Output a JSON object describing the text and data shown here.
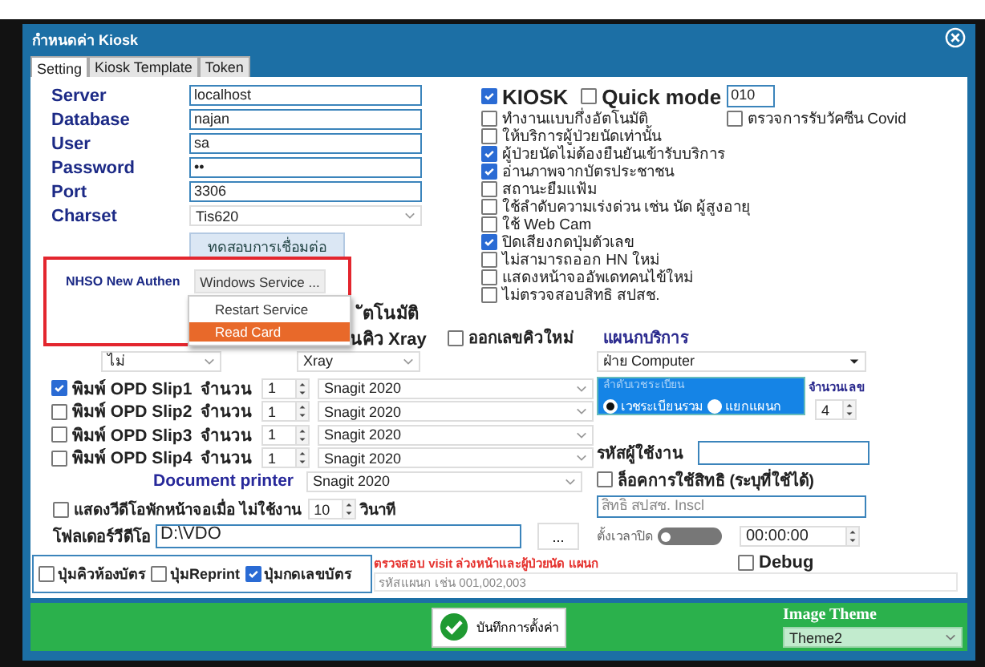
{
  "window": {
    "title": "กำหนดค่า Kiosk"
  },
  "tabs": [
    {
      "label": "Setting",
      "selected": true
    },
    {
      "label": "Kiosk Template",
      "selected": false
    },
    {
      "label": "Token",
      "selected": false
    }
  ],
  "connection": {
    "fields": [
      {
        "label": "Server",
        "value": "localhost",
        "kind": "text"
      },
      {
        "label": "Database",
        "value": "najan",
        "kind": "text"
      },
      {
        "label": "User",
        "value": "sa",
        "kind": "text"
      },
      {
        "label": "Password",
        "value": "••",
        "kind": "text"
      },
      {
        "label": "Port",
        "value": "3306",
        "kind": "text"
      },
      {
        "label": "Charset",
        "value": "Tis620",
        "kind": "select"
      }
    ],
    "test_button": "ทดสอบการเชื่อมต่อ"
  },
  "nhso": {
    "label": "NHSO New Authen",
    "button": "Windows Service ...",
    "menu": [
      {
        "label": "Restart Service",
        "selected": false
      },
      {
        "label": "Read Card",
        "selected": true
      }
    ]
  },
  "kiosk": {
    "label": "KIOSK",
    "checked": true
  },
  "quick_mode": {
    "label": "Quick mode",
    "checked": false,
    "value": "010"
  },
  "covid": {
    "label": "ตรวจการรับวัคซีน Covid",
    "checked": false
  },
  "options": [
    {
      "label": "ทำงานแบบกึ่งอัตโนมัติ",
      "checked": false
    },
    {
      "label": "ให้บริการผู้ป่วยนัดเท่านั้น",
      "checked": false
    },
    {
      "label": "ผู้ป่วยนัดไม่ต้องยืนยันเข้ารับบริการ",
      "checked": true
    },
    {
      "label": "อ่านภาพจากบัตรประชาชน",
      "checked": true
    },
    {
      "label": "สถานะยืมแฟ้ม",
      "checked": false
    },
    {
      "label": "ใช้ลำดับความเร่งด่วน เช่น นัด ผู้สูงอายุ",
      "checked": false
    },
    {
      "label": "ใช้ Web Cam",
      "checked": false
    },
    {
      "label": "ปิดเสียงกดปุ่มตัวเลข",
      "checked": true
    },
    {
      "label": "ไม่สามารถออก HN ใหม่",
      "checked": false
    },
    {
      "label": "แสดงหน้าจออัพเดทคนไข้ใหม่",
      "checked": false
    },
    {
      "label": "ไม่ตรวจสอบสิทธิ สปสช.",
      "checked": false
    }
  ],
  "partial": {
    "text_1": "ัตโนมัติ",
    "text_2": "นคิว Xray",
    "new_queue": {
      "label": "ออกเลขคิวใหม่",
      "checked": false
    },
    "select_1": "ไม่",
    "select_2": "Xray"
  },
  "department": {
    "label": "แผนกบริการ",
    "value": "ฝ่าย Computer"
  },
  "print_slips": [
    {
      "label": "พิมพ์ OPD Slip1",
      "checked": true,
      "count_label": "จำนวน",
      "count": "1",
      "printer": "Snagit 2020"
    },
    {
      "label": "พิมพ์ OPD Slip2",
      "checked": false,
      "count_label": "จำนวน",
      "count": "1",
      "printer": "Snagit 2020"
    },
    {
      "label": "พิมพ์ OPD Slip3",
      "checked": false,
      "count_label": "จำนวน",
      "count": "1",
      "printer": "Snagit 2020"
    },
    {
      "label": "พิมพ์ OPD Slip4",
      "checked": false,
      "count_label": "จำนวน",
      "count": "1",
      "printer": "Snagit 2020"
    }
  ],
  "document_printer": {
    "label": "Document printer",
    "value": "Snagit 2020"
  },
  "record_group": {
    "title": "ลำดับเวชระเบียน",
    "options": [
      {
        "label": "เวชระเบียนรวม",
        "selected": true
      },
      {
        "label": "แยกแผนก",
        "selected": false
      }
    ]
  },
  "digits": {
    "label": "จำนวนเลข",
    "value": "4"
  },
  "screensaver": {
    "label": "แสดงวีดีโอพักหน้าจอเมื่อ ไม่ใช้งาน",
    "checked": false,
    "value": "10",
    "unit": "วินาที"
  },
  "video_folder": {
    "label": "โฟลเดอร์วีดีโอ",
    "value": "D:\\VDO",
    "browse": "..."
  },
  "user_code": {
    "label": "รหัสผู้ใช้งาน"
  },
  "lock_rights": {
    "label": "ล็อคการใช้สิทธิ (ระบุที่ใช้ได้)",
    "checked": false
  },
  "rights_field": {
    "placeholder": "สิทธิ สปสช. Inscl"
  },
  "close_timer": {
    "label": "ตั้งเวลาปิด",
    "on": false,
    "time": "00:00:00"
  },
  "debug": {
    "label": "Debug",
    "checked": false
  },
  "buttons_group": [
    {
      "label": "ปุ่มคิวห้องบัตร",
      "checked": false
    },
    {
      "label": "ปุ่มReprint",
      "checked": false
    },
    {
      "label": "ปุ่มกดเลขบัตร",
      "checked": true
    }
  ],
  "visit_check": {
    "label": "ตรวจสอบ visit ล่วงหน้าและผู้ป่วยนัด แผนก",
    "placeholder": "รหัสแผนก เช่น 001,002,003"
  },
  "footer": {
    "save_button": "บันทึกการตั้งค่า",
    "theme_label": "Image Theme",
    "theme": "Theme2"
  }
}
